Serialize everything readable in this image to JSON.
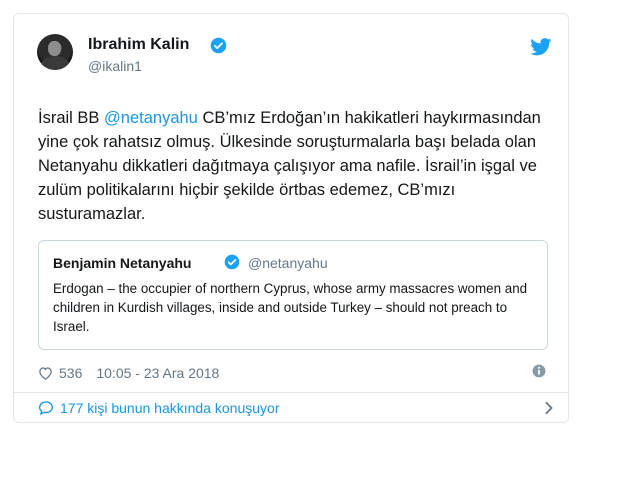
{
  "tweet": {
    "author_name": "Ibrahim Kalin",
    "author_handle": "@ikalin1",
    "text_line1_prefix": "İsrail BB ",
    "text_mention": "@netanyahu",
    "text_line1_suffix": " CB’mız Erdoğan’ın hakikatleri",
    "text_rest": "haykırmasından yine çok rahatsız olmuş. Ülkesinde soruşturmalarla başı belada olan Netanyahu dikkatleri dağıtmaya çalışıyor ama nafile. İsrail’in işgal ve zulüm politikalarını hiçbir şekilde örtbas edemez, CB’mızı susturamazlar.",
    "likes": "536",
    "timestamp": "10:05 - 23 Ara 2018",
    "conversation_text": "177 kişi bunun hakkında konuşuyor"
  },
  "quoted_tweet": {
    "author_name": "Benjamin Netanyahu",
    "author_handle": "@netanyahu",
    "text": "Erdogan – the occupier of northern Cyprus, whose army massacres women and children in Kurdish villages, inside and outside Turkey – should not preach to Israel."
  },
  "colors": {
    "link_blue": "#1b95e0",
    "verified_blue": "#1da1f2",
    "muted_gray": "#657786",
    "border": "#e1e8ed"
  },
  "icons": [
    "verified-badge-icon",
    "twitter-bird-icon",
    "heart-icon",
    "info-icon",
    "speech-bubble-icon",
    "chevron-right-icon"
  ]
}
